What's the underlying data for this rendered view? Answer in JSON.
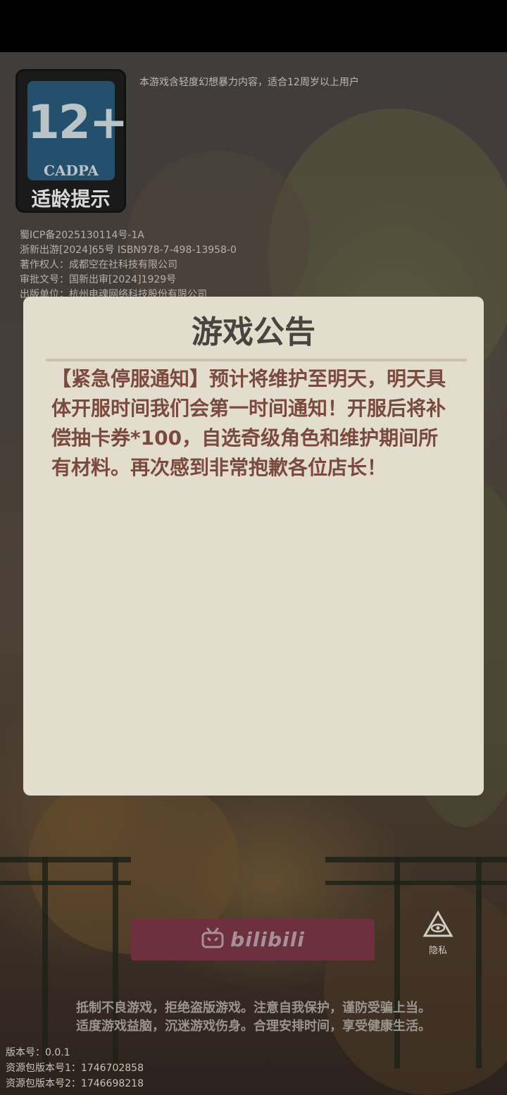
{
  "age_rating": {
    "number": "12+",
    "org": "CADPA",
    "caption": "适龄提示",
    "note": "本游戏含轻度幻想暴力内容，适合12周岁以上用户"
  },
  "licenses": [
    "蜀ICP备2025130114号-1A",
    "浙新出游[2024]65号 ISBN978-7-498-13958-0",
    "著作权人：成都空在社科技有限公司",
    "审批文号：国新出审[2024]1929号",
    "出版单位：杭州电魂网络科技股份有限公司"
  ],
  "notice": {
    "title": "游戏公告",
    "body": "【紧急停服通知】预计将维护至明天，明天具体开服时间我们会第一时间通知！开服后将补偿抽卡券*100，自选奇级角色和维护期间所有材料。再次感到非常抱歉各位店长！"
  },
  "login": {
    "bilibili_label": "bilibili",
    "privacy_label": "隐私"
  },
  "warnings": [
    "抵制不良游戏，拒绝盗版游戏。注意自我保护，谨防受骗上当。",
    "适度游戏益脑，沉迷游戏伤身。合理安排时间，享受健康生活。"
  ],
  "versions": [
    "版本号：0.0.1",
    "资源包版本号1：1746702858",
    "资源包版本号2：1746698218"
  ],
  "icons": {
    "bilibili": "bilibili-tv-icon",
    "privacy": "eye-triangle-icon"
  },
  "colors": {
    "modal_bg": "#e3ddce",
    "notice_text": "#7a4a3e",
    "bili_button": "#6e2f3e"
  }
}
